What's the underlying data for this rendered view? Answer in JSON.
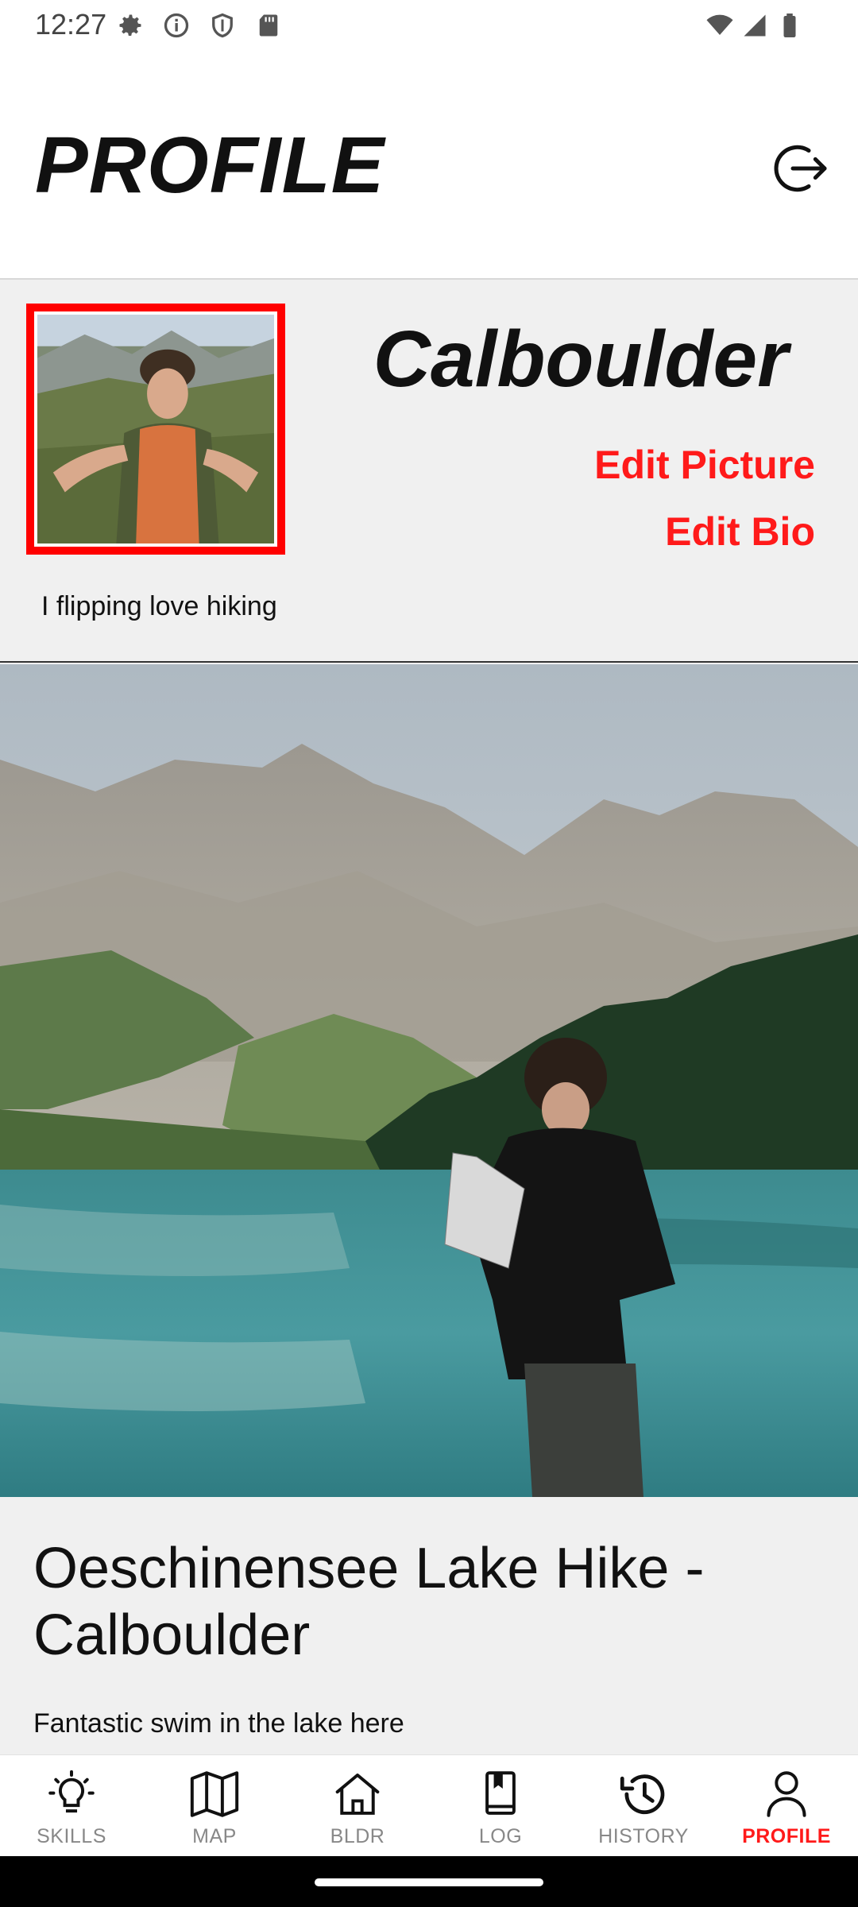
{
  "status_bar": {
    "time": "12:27",
    "left_icons": [
      "gear-icon",
      "info-icon",
      "shield-icon",
      "sd-card-icon"
    ],
    "right_icons": [
      "wifi-icon",
      "cell-signal-icon",
      "battery-icon"
    ]
  },
  "header": {
    "title": "PROFILE",
    "logout_icon": "logout-icon"
  },
  "profile": {
    "username": "Calboulder",
    "edit_picture_label": "Edit Picture",
    "edit_bio_label": "Edit Bio",
    "bio": "I flipping love hiking",
    "avatar_border_color": "#ff0000"
  },
  "post": {
    "title": "Oeschinensee Lake Hike - Calboulder",
    "caption": "Fantastic swim in the lake here"
  },
  "bottom_nav": {
    "items": [
      {
        "label": "SKILLS",
        "icon": "lightbulb-icon",
        "active": false
      },
      {
        "label": "MAP",
        "icon": "map-icon",
        "active": false
      },
      {
        "label": "BLDR",
        "icon": "home-icon",
        "active": false
      },
      {
        "label": "LOG",
        "icon": "book-icon",
        "active": false
      },
      {
        "label": "HISTORY",
        "icon": "history-icon",
        "active": false
      },
      {
        "label": "PROFILE",
        "icon": "person-icon",
        "active": true
      }
    ],
    "active_color": "#ff1a1a",
    "inactive_color": "#888888"
  }
}
